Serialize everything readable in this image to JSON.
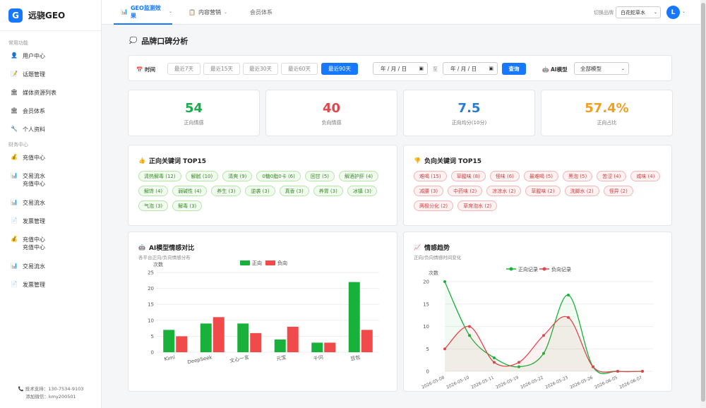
{
  "app": {
    "logo_letter": "G",
    "logo_text": "远骁GEO"
  },
  "sidebar": {
    "section1": "常用功能",
    "items1": [
      {
        "icon": "👤",
        "label": "用户中心"
      },
      {
        "icon": "📝",
        "label": "话题管理"
      },
      {
        "icon": "🏛",
        "label": "媒体资源列表"
      },
      {
        "icon": "🏛",
        "label": "会员体系"
      },
      {
        "icon": "🔧",
        "label": "个人资料"
      }
    ],
    "section2": "财务中心",
    "items2": [
      {
        "icon": "💰",
        "lines": [
          "充值中心"
        ]
      },
      {
        "icon": "📊",
        "lines": [
          "交易流水",
          "充值中心"
        ]
      },
      {
        "icon": "📊",
        "lines": [
          "交易流水"
        ]
      },
      {
        "icon": "📄",
        "lines": [
          "发票管理"
        ]
      },
      {
        "icon": "💰",
        "lines": [
          "充值中心",
          "充值中心"
        ]
      },
      {
        "icon": "📊",
        "lines": [
          "交易流水"
        ]
      },
      {
        "icon": "📄",
        "lines": [
          "发票管理"
        ]
      }
    ],
    "footer_support": "技术支持：130-7534-9103",
    "footer_wechat": "添加微信：kmy200501"
  },
  "topbar": {
    "tabs": [
      {
        "icon": "📊",
        "label": "GEO监测效果",
        "caret": "⌄"
      },
      {
        "icon": "📋",
        "label": "内容营销",
        "caret": "⌄"
      },
      {
        "label": "会员体系"
      }
    ],
    "brand_label": "切换品牌",
    "brand_value": "白花蛇草水",
    "avatar_letter": "L"
  },
  "page": {
    "title_icon": "💭",
    "title": "品牌口碑分析"
  },
  "filter": {
    "time_label": "时间",
    "ranges": [
      "最近7天",
      "最近15天",
      "最近30天",
      "最近60天",
      "最近90天"
    ],
    "active_range": 4,
    "date_start": "年 / 月 / 日",
    "date_end": "年 / 月 / 日",
    "to_label": "至",
    "query_label": "查询",
    "model_label": "AI模型",
    "model_value": "全部模型"
  },
  "stats": [
    {
      "value": "54",
      "label": "正向情感",
      "color": "#1aad4b"
    },
    {
      "value": "40",
      "label": "负向情感",
      "color": "#e0474c"
    },
    {
      "value": "7.5",
      "label": "正向均分(10分)",
      "color": "#2a7bd6"
    },
    {
      "value": "57.4%",
      "label": "正向占比",
      "color": "#f0a020"
    }
  ],
  "positive": {
    "title": "正向关键词 TOP15",
    "icon": "👍",
    "tags": [
      "清热解毒 (12)",
      "解腻 (10)",
      "清爽 (9)",
      "0糖0脂0卡 (6)",
      "回甘 (5)",
      "解酒护肝 (4)",
      "解馋 (4)",
      "弱碱性 (4)",
      "养生 (3)",
      "逆袭 (3)",
      "真香 (3)",
      "养胃 (3)",
      "冰镇 (3)",
      "气泡 (3)",
      "解毒 (3)"
    ]
  },
  "negative": {
    "title": "负向关键词 TOP15",
    "icon": "👎",
    "tags": [
      "难喝 (15)",
      "草腥味 (8)",
      "怪味 (6)",
      "最难喝 (5)",
      "黑泡 (5)",
      "苦涩 (4)",
      "咸味 (4)",
      "减腰 (3)",
      "中药味 (2)",
      "凉凉水 (2)",
      "草腥味 (2)",
      "洗脚水 (2)",
      "怪异 (2)",
      "两极分化 (2)",
      "草席泡水 (2)"
    ]
  },
  "model_card": {
    "title": "AI模型情感对比",
    "icon": "🤖",
    "subtitle": "各平台正向/负向情感分布"
  },
  "trend_card": {
    "title": "情感趋势",
    "icon": "📈",
    "subtitle": "正向/负向情感时间变化"
  },
  "chart_data": [
    {
      "type": "bar",
      "categories": [
        "Kimi",
        "DeepSeek",
        "文心一言",
        "元宝",
        "千问",
        "豆包"
      ],
      "series": [
        {
          "name": "正向",
          "values": [
            7,
            9,
            9,
            4,
            3,
            22
          ],
          "color": "#18b23a"
        },
        {
          "name": "负向",
          "values": [
            5,
            11,
            6,
            8,
            3,
            7
          ],
          "color": "#f04a4a"
        }
      ],
      "ylabel": "次数",
      "ylim": [
        0,
        25
      ],
      "yticks": [
        0,
        5,
        10,
        15,
        20,
        25
      ],
      "legend": "top-center",
      "grid": true
    },
    {
      "type": "line",
      "x": [
        "2026-05-08",
        "2026-05-10",
        "2026-05-11",
        "2026-05-19",
        "2026-05-22",
        "2026-05-23",
        "2026-05-26",
        "2026-06-05",
        "2026-06-07"
      ],
      "x_tick_labels": [
        "2026-05-08",
        "2026-05-10",
        "2026-05-11",
        "2026-05-19",
        "2026-05-22",
        "2026-05-23",
        "2026-05-26",
        "2026-06-05",
        "2026-06-07"
      ],
      "series": [
        {
          "name": "正向记录",
          "values": [
            20,
            8,
            3,
            1,
            4,
            17,
            1,
            0,
            0
          ],
          "color": "#18b23a"
        },
        {
          "name": "负向记录",
          "values": [
            5,
            10,
            2,
            2,
            8,
            12,
            1,
            0,
            0
          ],
          "color": "#e0474c"
        }
      ],
      "ylabel": "次数",
      "ylim": [
        0,
        20
      ],
      "yticks": [
        0,
        5,
        10,
        15,
        20
      ],
      "legend": "top-center",
      "grid": true
    }
  ]
}
